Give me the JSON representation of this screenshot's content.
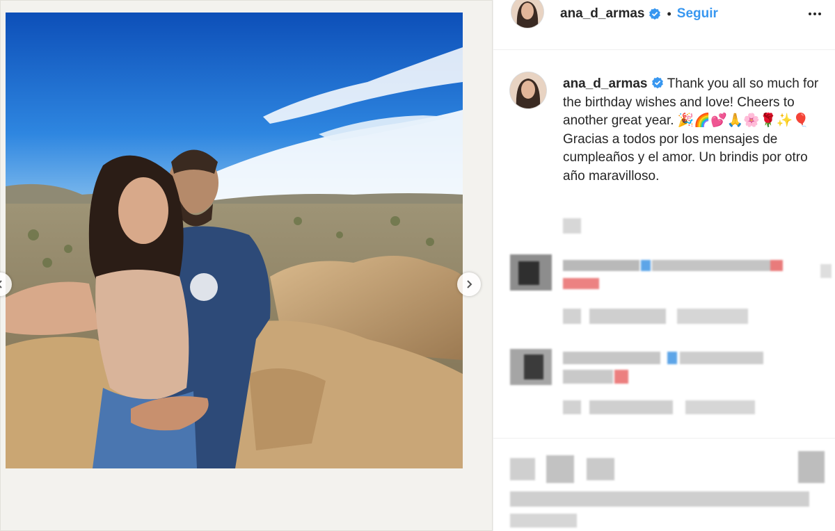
{
  "post": {
    "username": "ana_d_armas",
    "follow_label": "Seguir",
    "separator": "•",
    "caption_line_en": "Thank you all so much for the birthday wishes and love! Cheers to another great year. 🎉🌈💕🙏🌸🌹✨🎈",
    "caption_line_es": "Gracias a todos por los mensajes de cumpleaños y el amor. Un brindis por otro año maravilloso."
  },
  "icons": {
    "verified": "verified-badge-icon",
    "more": "more-options-icon",
    "prev": "chevron-left-icon",
    "next": "chevron-right-icon"
  },
  "colors": {
    "follow": "#3897f0",
    "verified": "#3897f0",
    "text": "#262626",
    "sky": "#1f6fd6"
  }
}
